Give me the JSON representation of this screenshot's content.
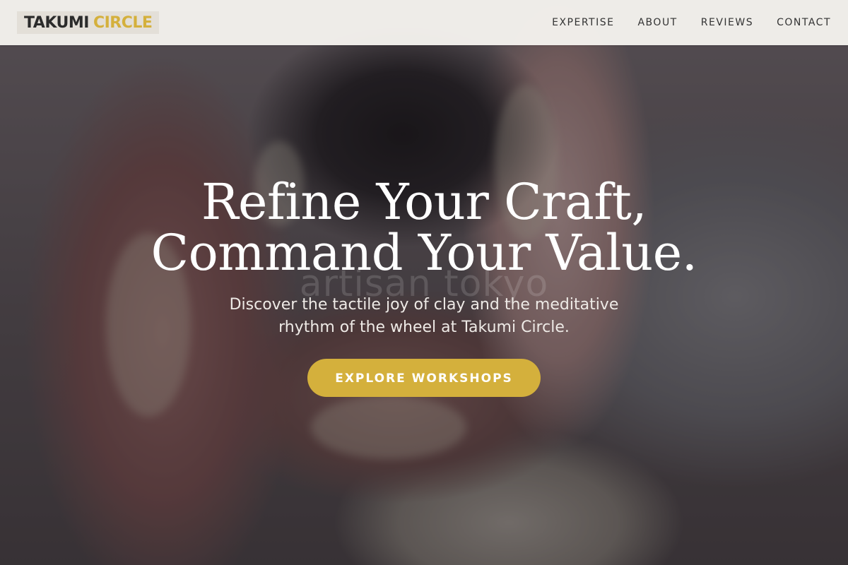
{
  "header": {
    "logo": {
      "part1": "TAKUMI",
      "part2": "CIRCLE"
    },
    "nav": [
      {
        "label": "EXPERTISE"
      },
      {
        "label": "ABOUT"
      },
      {
        "label": "REVIEWS"
      },
      {
        "label": "CONTACT"
      }
    ]
  },
  "hero": {
    "title_line1": "Refine Your Craft,",
    "title_line2": "Command Your Value.",
    "watermark": "artisan tokyo",
    "subtitle": "Discover the tactile joy of clay and the meditative rhythm of the wheel at Takumi Circle.",
    "cta_label": "EXPLORE WORKSHOPS"
  },
  "colors": {
    "accent": "#d4b03c",
    "header_bg": "#f5f3ee",
    "logo_dark": "#2b2b2b"
  }
}
